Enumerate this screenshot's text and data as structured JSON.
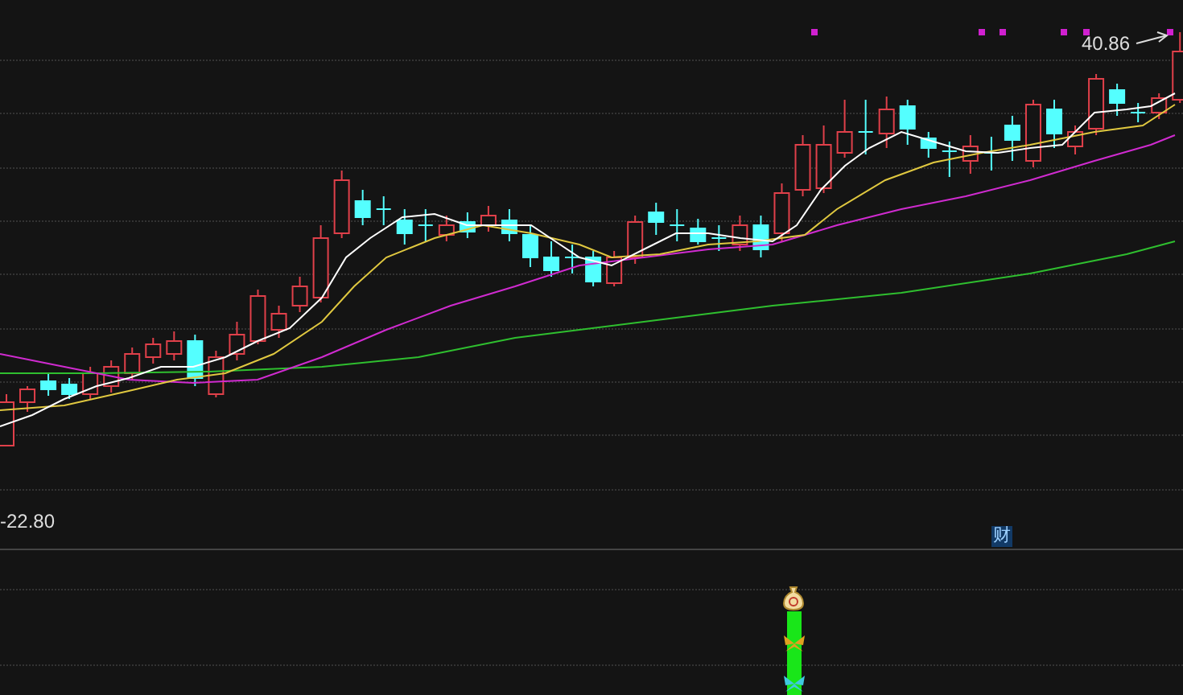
{
  "price_chart": {
    "high_label": "40.86",
    "low_label": "-22.80",
    "event_badge": "财"
  }
}
